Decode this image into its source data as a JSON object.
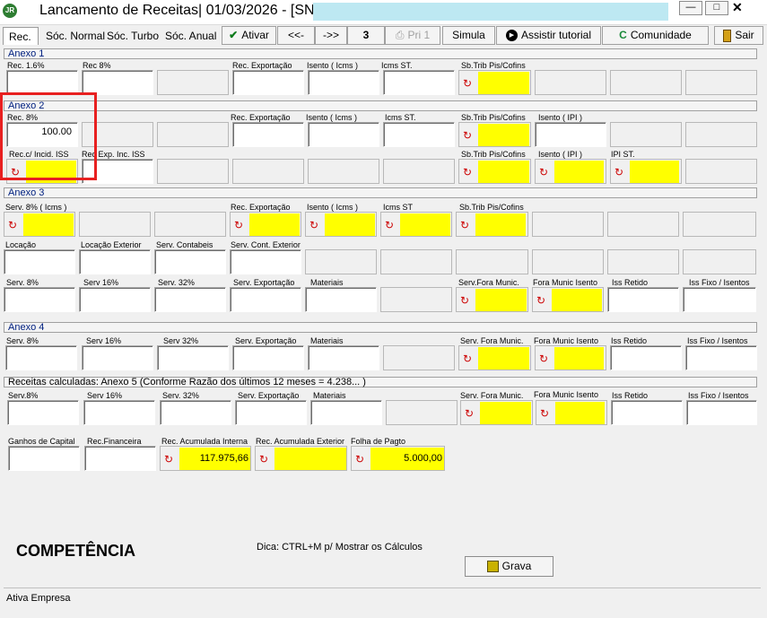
{
  "window": {
    "logo_text": "JR",
    "title": "Lancamento de Receitas|  01/03/2026 - [SN] -",
    "minimize": "—",
    "maximize": "□",
    "close": "✕"
  },
  "toolbar": {
    "tabs": [
      "Rec.",
      "Sóc. Normal",
      "Sóc. Turbo",
      "Sóc. Anual"
    ],
    "ativar": "Ativar",
    "prev": "<<-",
    "next": "->>",
    "count": "3",
    "pri": "Pri 1",
    "simula": "Simula",
    "assistir": "Assistir tutorial",
    "comunidade": "Comunidade",
    "sair": "Sair"
  },
  "anexo1": {
    "title": "Anexo 1",
    "rec16": "Rec. 1.6%",
    "rec8": "Rec 8%",
    "rec_exportacao": "Rec. Exportação",
    "isento_icms": "Isento ( Icms )",
    "icms_st": "Icms ST.",
    "sb_trib": "Sb.Trib Pis/Cofins"
  },
  "anexo2": {
    "title": "Anexo 2",
    "rec8": "Rec. 8%",
    "rec8_value": "100.00",
    "rec_exportacao": "Rec. Exportação",
    "isento_icms": "Isento ( Icms )",
    "icms_st": "Icms ST.",
    "sb_trib": "Sb.Trib Pis/Cofins",
    "isento_ipi": "Isento ( IPI )",
    "rec_incid_iss": "Rec.c/ Incid. ISS",
    "rec_exp_inc_iss": "Rec Exp. Inc. ISS",
    "sb_trib2": "Sb.Trib Pis/Cofins",
    "isento_ipi2": "Isento ( IPI )",
    "ipi_st": "IPI ST."
  },
  "anexo3": {
    "title": "Anexo 3",
    "serv8_icms": "Serv. 8% ( Icms )",
    "rec_exportacao": "Rec. Exportação",
    "isento_icms": "Isento ( Icms )",
    "icms_st": "Icms ST",
    "sb_trib": "Sb.Trib Pis/Cofins",
    "locacao": "Locação",
    "locacao_exterior": "Locação Exterior",
    "serv_contabeis": "Serv. Contabeis",
    "serv_cont_exterior": "Serv. Cont. Exterior",
    "serv8": "Serv. 8%",
    "serv16": "Serv 16%",
    "serv32": "Serv. 32%",
    "serv_exportacao": "Serv. Exportação",
    "materiais": "Materiais",
    "serv_fora_munic": "Serv.Fora Munic.",
    "fora_munic_isento": "Fora Munic Isento",
    "iss_retido": "Iss Retido",
    "iss_fixo": "Iss Fixo / Isentos"
  },
  "anexo4": {
    "title": "Anexo 4",
    "serv8": "Serv. 8%",
    "serv16": "Serv 16%",
    "serv32": "Serv 32%",
    "serv_exportacao": "Serv. Exportação",
    "materiais": "Materiais",
    "serv_fora_munic": "Serv. Fora Munic.",
    "fora_munic_isento": "Fora Munic Isento",
    "iss_retido": "Iss Retido",
    "iss_fixo": "Iss Fixo / Isentos"
  },
  "anexo5": {
    "title": "Receitas calculadas: Anexo 5 (Conforme Razão dos últimos 12 meses = 4.238... )",
    "serv8": "Serv.8%",
    "serv16": "Serv 16%",
    "serv32": "Serv. 32%",
    "serv_exportacao": "Serv. Exportação",
    "materiais": "Materiais",
    "serv_fora_munic": "Serv. Fora Munic.",
    "fora_munic_isento": "Fora Munic Isento",
    "iss_retido": "Iss Retido",
    "iss_fixo": "Iss Fixo / Isentos"
  },
  "outros": {
    "ganhos_capital": "Ganhos de Capital",
    "rec_financeira": "Rec.Financeira",
    "rec_acum_interna": "Rec. Acumulada Interna",
    "rec_acum_interna_value": "117.975,66",
    "rec_acum_exterior": "Rec. Acumulada Exterior",
    "folha_pagto": "Folha de Pagto",
    "folha_pagto_value": "5.000,00"
  },
  "footer": {
    "competencia": "COMPETÊNCIA",
    "dica": "Dica: CTRL+M p/ Mostrar os Cálculos",
    "grava": "Grava",
    "status": "Ativa Empresa"
  },
  "arrow_glyph": "↻",
  "colors": {
    "highlight": "#ffff00",
    "section_title": "#002080",
    "annotation": "#e82020"
  }
}
